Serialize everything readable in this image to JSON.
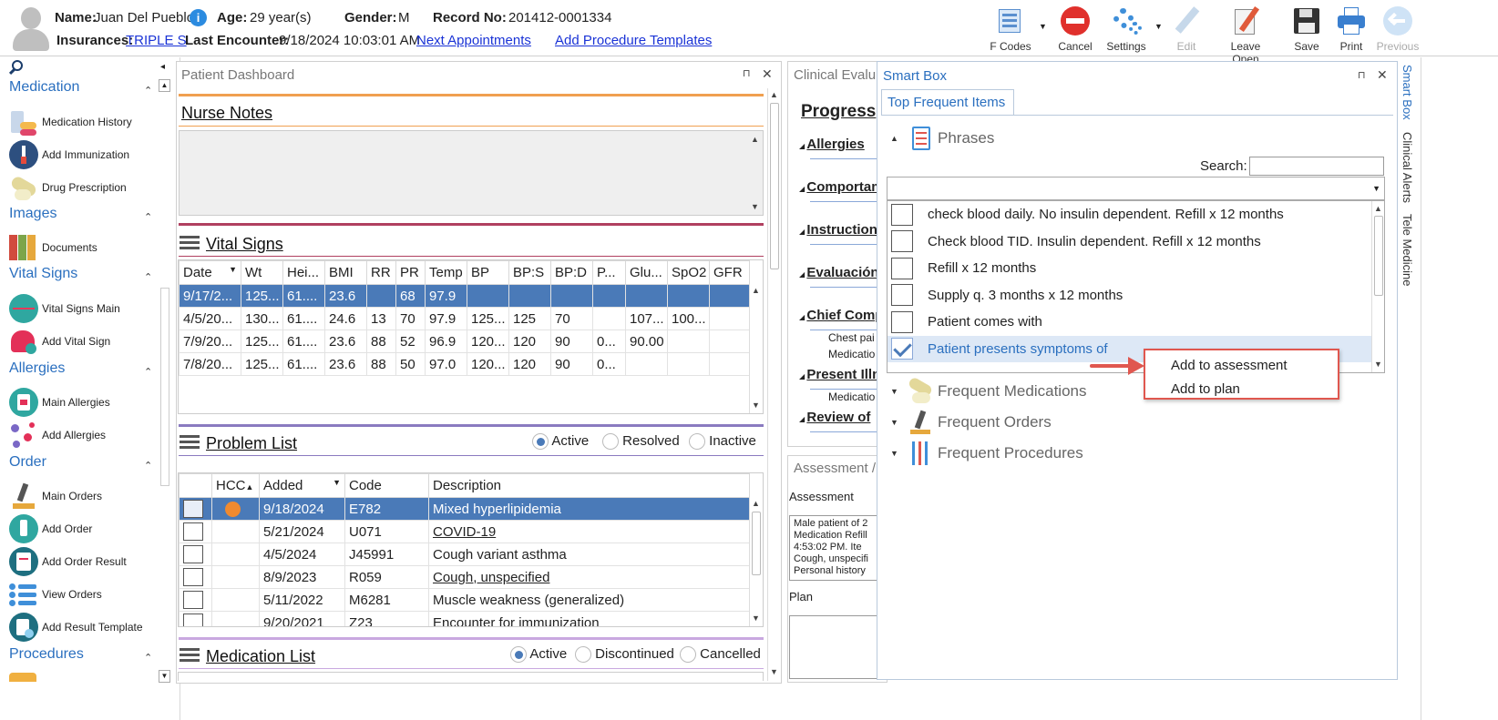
{
  "header": {
    "name_label": "Name:",
    "name_value": "Juan Del Pueblo",
    "age_label": "Age:",
    "age_value": "29 year(s)",
    "gender_label": "Gender:",
    "gender_value": "M",
    "record_label": "Record No:",
    "record_value": "201412-0001334",
    "insurances_label": "Insurances:",
    "insurances_value": "TRIPLE S",
    "last_encounter_label": "Last Encounter:",
    "last_encounter_value": "9/18/2024 10:03:01 AM",
    "next_appointments": "Next Appointments",
    "add_procedure_templates": "Add Procedure Templates",
    "info_icon": "i"
  },
  "toolbar": {
    "fcodes": "F Codes",
    "cancel": "Cancel",
    "settings": "Settings",
    "edit": "Edit",
    "leave_open": "Leave Open",
    "save": "Save",
    "print": "Print",
    "previous": "Previous"
  },
  "sidebar": {
    "collapse_glyph": "◂",
    "sections": [
      {
        "title": "Medication",
        "items": [
          "Medication History",
          "Add Immunization",
          "Drug Prescription"
        ]
      },
      {
        "title": "Images",
        "items": [
          "Documents"
        ]
      },
      {
        "title": "Vital Signs",
        "items": [
          "Vital Signs Main",
          "Add Vital Sign"
        ]
      },
      {
        "title": "Allergies",
        "items": [
          "Main Allergies",
          "Add Allergies"
        ]
      },
      {
        "title": "Order",
        "items": [
          "Main Orders",
          "Add Order",
          "Add Order Result",
          "View Orders",
          "Add Result Template"
        ]
      },
      {
        "title": "Procedures",
        "items": []
      }
    ]
  },
  "dashboard": {
    "title": "Patient Dashboard",
    "pin": "⊓",
    "close": "✕",
    "nurse_notes": "Nurse Notes",
    "vital_signs": {
      "title": "Vital Signs",
      "columns": [
        "Date",
        "Wt",
        "Hei...",
        "BMI",
        "RR",
        "PR",
        "Temp",
        "BP",
        "BP:S",
        "BP:D",
        "P...",
        "Glu...",
        "SpO2",
        "GFR"
      ],
      "rows": [
        [
          "9/17/2...",
          "125...",
          "61....",
          "23.6",
          "",
          "68",
          "97.9",
          "",
          "",
          "",
          "",
          "",
          "",
          ""
        ],
        [
          "4/5/20...",
          "130...",
          "61....",
          "24.6",
          "13",
          "70",
          "97.9",
          "125...",
          "125",
          "70",
          "",
          "107...",
          "100...",
          ""
        ],
        [
          "7/9/20...",
          "125...",
          "61....",
          "23.6",
          "88",
          "52",
          "96.9",
          "120...",
          "120",
          "90",
          "0...",
          "90.00",
          "",
          ""
        ],
        [
          "7/8/20...",
          "125...",
          "61....",
          "23.6",
          "88",
          "50",
          "97.0",
          "120...",
          "120",
          "90",
          "0...",
          "",
          "",
          ""
        ]
      ]
    },
    "problem_list": {
      "title": "Problem List",
      "filters": [
        "Active",
        "Resolved",
        "Inactive"
      ],
      "columns": [
        "",
        "HCC",
        "Added",
        "Code",
        "Description"
      ],
      "rows": [
        {
          "added": "9/18/2024",
          "code": "E782",
          "description": "Mixed hyperlipidemia",
          "link": false
        },
        {
          "added": "5/21/2024",
          "code": "U071",
          "description": "COVID-19",
          "link": true
        },
        {
          "added": "4/5/2024",
          "code": "J45991",
          "description": "Cough variant asthma",
          "link": false
        },
        {
          "added": "8/9/2023",
          "code": "R059",
          "description": "Cough, unspecified",
          "link": true
        },
        {
          "added": "5/11/2022",
          "code": "M6281",
          "description": "Muscle weakness (generalized)",
          "link": false
        },
        {
          "added": "9/20/2021",
          "code": "Z23",
          "description": "Encounter for immunization",
          "link": false
        }
      ]
    },
    "medication_list": {
      "title": "Medication List",
      "filters": [
        "Active",
        "Discontinued",
        "Cancelled"
      ]
    }
  },
  "clinical": {
    "title": "Clinical Evalu",
    "progress": "Progress",
    "sections": [
      "Allergies",
      "Comportam",
      "Instruction",
      "Evaluación",
      "Chief Comp",
      "Present Illn",
      "Review of"
    ],
    "chief_sub": [
      "Chest pai",
      "Medicatio"
    ],
    "present_sub": [
      "Medicatio"
    ],
    "assessment_title": "Assessment /",
    "assessment_label": "Assessment",
    "assessment_text": [
      "Male patient of 2",
      "Medication Refill",
      "4:53:02 PM.   Ite",
      "Cough, unspecifi",
      "Personal history"
    ],
    "plan_label": "Plan"
  },
  "smartbox": {
    "title": "Smart Box",
    "tab": "Top Frequent Items",
    "phrases_group": "Phrases",
    "search_label": "Search:",
    "phrases": [
      {
        "text": "check blood daily. No insulin dependent. Refill x 12 months",
        "checked": false
      },
      {
        "text": "Check blood TID. Insulin dependent. Refill x 12 months",
        "checked": false
      },
      {
        "text": "Refill x 12 months",
        "checked": false
      },
      {
        "text": "Supply q. 3 months x 12 months",
        "checked": false
      },
      {
        "text": "Patient comes with",
        "checked": false
      },
      {
        "text": "Patient presents symptoms of",
        "checked": true
      }
    ],
    "groups": [
      "Frequent Medications",
      "Frequent Orders",
      "Frequent Procedures"
    ],
    "context_menu": [
      "Add to assessment",
      "Add to plan"
    ]
  },
  "vtabs": [
    "Smart Box",
    "Clinical Alerts",
    "Tele Medicine"
  ]
}
